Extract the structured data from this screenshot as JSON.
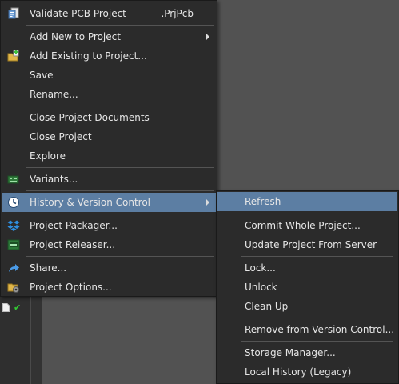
{
  "project_menu": {
    "items": [
      {
        "label": "Validate PCB Project",
        "shortcut": ".PrjPcb",
        "icon": "validate-project-icon"
      },
      {
        "label": "Add New to Project",
        "submenu": true
      },
      {
        "label": "Add Existing to Project...",
        "icon": "add-existing-icon"
      },
      {
        "label": "Save"
      },
      {
        "label": "Rename..."
      },
      {
        "label": "Close Project Documents"
      },
      {
        "label": "Close Project"
      },
      {
        "label": "Explore"
      },
      {
        "label": "Variants...",
        "icon": "variants-icon"
      },
      {
        "label": "History & Version Control",
        "submenu": true,
        "highlighted": true,
        "icon": "history-clock-icon"
      },
      {
        "label": "Project Packager...",
        "icon": "dropbox-icon"
      },
      {
        "label": "Project Releaser...",
        "icon": "releaser-icon"
      },
      {
        "label": "Share...",
        "icon": "share-arrow-icon"
      },
      {
        "label": "Project Options...",
        "icon": "project-options-icon"
      }
    ]
  },
  "history_submenu": {
    "items": [
      {
        "label": "Refresh",
        "highlighted": true
      },
      {
        "label": "Commit Whole Project..."
      },
      {
        "label": "Update Project From Server"
      },
      {
        "label": "Lock..."
      },
      {
        "label": "Unlock"
      },
      {
        "label": "Clean Up"
      },
      {
        "label": "Remove from Version Control..."
      },
      {
        "label": "Storage Manager..."
      },
      {
        "label": "Local History (Legacy)"
      }
    ]
  },
  "tree": {
    "status_icons": [
      "document-icon",
      "check-icon"
    ],
    "check_glyph": "✔"
  },
  "colors": {
    "highlight": "#5c7ea3",
    "menu_bg": "#2b2b2b",
    "text": "#e6e6e6",
    "check": "#33cc33"
  }
}
